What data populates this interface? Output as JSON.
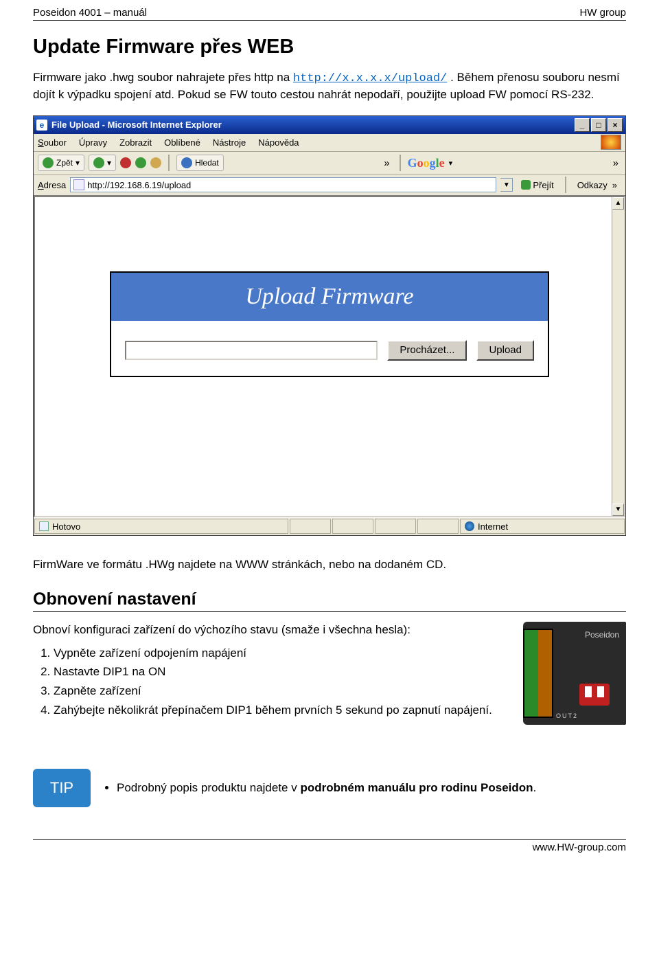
{
  "header": {
    "left": "Poseidon 4001 – manuál",
    "right": "HW group"
  },
  "title": "Update Firmware přes WEB",
  "intro_pre": "Firmware jako .hwg soubor nahrajete přes http na ",
  "intro_url": "http://x.x.x.x/upload/",
  "intro_post": ". Během přenosu souboru nesmí dojít k výpadku spojení atd. Pokud se FW touto cestou nahrát nepodaří, použijte upload FW pomocí RS-232.",
  "browser": {
    "title": "File Upload - Microsoft Internet Explorer",
    "menus": [
      "Soubor",
      "Úpravy",
      "Zobrazit",
      "Oblíbené",
      "Nástroje",
      "Nápověda"
    ],
    "toolbar": {
      "back": "Zpět",
      "search": "Hledat",
      "google": "Google"
    },
    "address_label": "Adresa",
    "address_value": "http://192.168.6.19/upload",
    "go": "Přejít",
    "links": "Odkazy",
    "upload_heading": "Upload Firmware",
    "browse_btn": "Procházet...",
    "upload_btn": "Upload",
    "status_done": "Hotovo",
    "status_zone": "Internet"
  },
  "caption1": "FirmWare ve formátu .HWg najdete na WWW stránkách, nebo na dodaném CD.",
  "section2_title": "Obnovení nastavení",
  "section2_intro": "Obnoví konfiguraci zařízení do výchozího stavu (smaže i všechna hesla):",
  "steps": [
    "Vypněte zařízení odpojením napájení",
    "Nastavte DIP1 na ON",
    "Zapněte zařízení",
    "Zahýbejte několikrát přepínačem DIP1 během prvních 5 sekund po zapnutí napájení."
  ],
  "tip_label": "TIP",
  "tip_pre": "Podrobný popis produktu najdete v ",
  "tip_bold": "podrobném manuálu pro rodinu Poseidon",
  "tip_post": ".",
  "footer": "www.HW-group.com"
}
